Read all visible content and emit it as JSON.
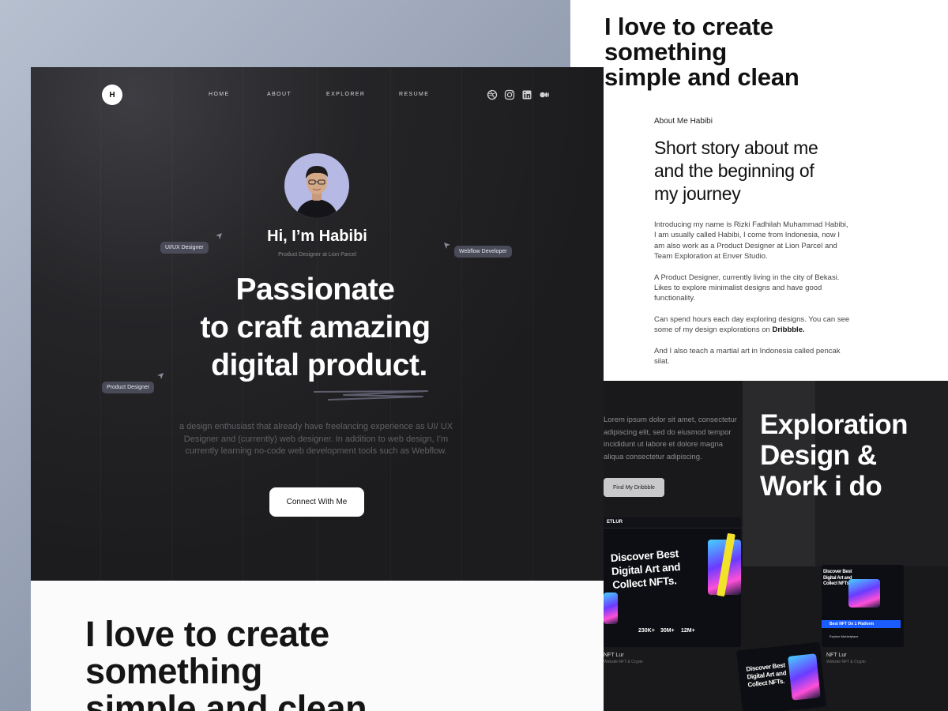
{
  "main": {
    "logo_letter": "H",
    "nav": [
      "HOME",
      "ABOUT",
      "EXPLORER",
      "RESUME"
    ],
    "social_icons": [
      "dribbble-icon",
      "instagram-icon",
      "linkedin-icon",
      "medium-icon"
    ],
    "greeting": "Hi, I’m Habibi",
    "role": "Product Designer at Lion Parcel",
    "tags": [
      "UI/UX Designer",
      "Webflow Developer",
      "Product Designer"
    ],
    "headline": [
      "Passionate",
      "to craft amazing",
      "digital product."
    ],
    "description": "a design enthusiast that already have freelancing experience as UI/ UX Designer and (currently) web designer. In addition to web design, I’m currently learning no-code web development tools such as Webflow.",
    "cta": "Connect With Me"
  },
  "bottom": {
    "heading": [
      "I love to create",
      "something",
      "simple and clean"
    ]
  },
  "about_panel": {
    "heading": [
      "I love to create",
      "something",
      "simple and clean"
    ],
    "label": "About Me Habibi",
    "title": [
      "Short story about me",
      "and the beginning of",
      "my journey"
    ],
    "p1": "Introducing my name is Rizki Fadhilah Muhammad Habibi, I am usually called Habibi, I come from Indonesia, now I am also work as a Product Designer at Lion Parcel and Team Exploration at Enver Studio.",
    "p2": "A Product Designer, currently living in the city of Bekasi. Likes to explore minimalist designs and have good functionality.",
    "p3_text": "Can spend hours each day exploring designs. You can see some of my design explorations on ",
    "p3_link": "Dribbble.",
    "p4": "And I also teach a martial art in Indonesia called pencak silat."
  },
  "work_panel": {
    "lorem": "Lorem ipsum dolor sit amet, consectetur adipiscing elit, sed do eiusmod tempor incididunt ut labore et dolore magna aliqua consectetur adipiscing.",
    "button": "Find My Dribbble",
    "heading": [
      "Exploration",
      "Design &",
      "Work i do"
    ],
    "shot1": {
      "logo": "ETLUR",
      "title": [
        "Discover Best",
        "Digital Art and",
        "Collect NFTs."
      ],
      "stats": [
        "230K+",
        "30M+",
        "12M+"
      ],
      "name": "NFT Lur",
      "sub": "Website NFT & Crypto"
    },
    "shot2": {
      "title": [
        "Discover Best",
        "Digital Art and",
        "Collect NFTs."
      ],
      "banner": "Best NFT On 1 Platform",
      "button": "Explore Marketplace",
      "name": "NFT Lur",
      "sub": "Website NFT & Crypto"
    },
    "shot3": {
      "title": [
        "Discover Best",
        "Digital Art and",
        "Collect NFTs."
      ]
    }
  }
}
